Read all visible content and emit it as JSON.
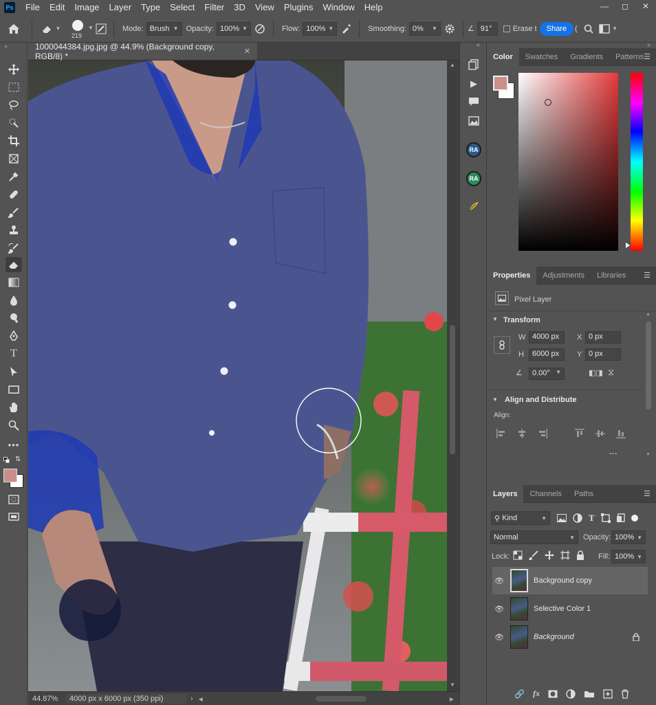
{
  "app": {
    "logo": "Ps"
  },
  "menu": [
    "File",
    "Edit",
    "Image",
    "Layer",
    "Type",
    "Select",
    "Filter",
    "3D",
    "View",
    "Plugins",
    "Window",
    "Help"
  ],
  "window_controls": [
    "minimize-icon",
    "maximize-icon",
    "close-icon"
  ],
  "options": {
    "brush_size": "219",
    "mode_label": "Mode:",
    "mode_value": "Brush",
    "opacity_label": "Opacity:",
    "opacity_value": "100%",
    "flow_label": "Flow:",
    "flow_value": "100%",
    "smoothing_label": "Smoothing:",
    "smoothing_value": "0%",
    "angle_value": "91°",
    "erase_label": "Erase t",
    "share_label": "Share",
    "paren": "("
  },
  "document": {
    "tab_title": "1000044384.jpg.jpg @ 44.9% (Background copy, RGB/8) *",
    "zoom": "44.87%",
    "size_info": "4000 px x 6000 px (350 ppi)"
  },
  "color_panel": {
    "tabs": [
      "Color",
      "Swatches",
      "Gradients",
      "Patterns"
    ],
    "foreground": "#c98f8a",
    "background": "#ffffff",
    "hue_color": "#e53a3a"
  },
  "properties_panel": {
    "tabs": [
      "Properties",
      "Adjustments",
      "Libraries"
    ],
    "layer_type": "Pixel Layer",
    "transform_title": "Transform",
    "w_label": "W",
    "w_value": "4000 px",
    "h_label": "H",
    "h_value": "6000 px",
    "x_label": "X",
    "x_value": "0 px",
    "y_label": "Y",
    "y_value": "0 px",
    "angle_value": "0.00°",
    "align_title": "Align and Distribute",
    "align_label": "Align:",
    "more": "..."
  },
  "layers_panel": {
    "tabs": [
      "Layers",
      "Channels",
      "Paths"
    ],
    "filter_kind": "Kind",
    "blend_mode": "Normal",
    "opacity_label": "Opacity:",
    "opacity_value": "100%",
    "lock_label": "Lock:",
    "fill_label": "Fill:",
    "fill_value": "100%",
    "layers": [
      {
        "name": "Background copy",
        "selected": true,
        "locked": false
      },
      {
        "name": "Selective Color 1",
        "selected": false,
        "locked": false
      },
      {
        "name": "Background",
        "selected": false,
        "locked": true
      }
    ]
  }
}
